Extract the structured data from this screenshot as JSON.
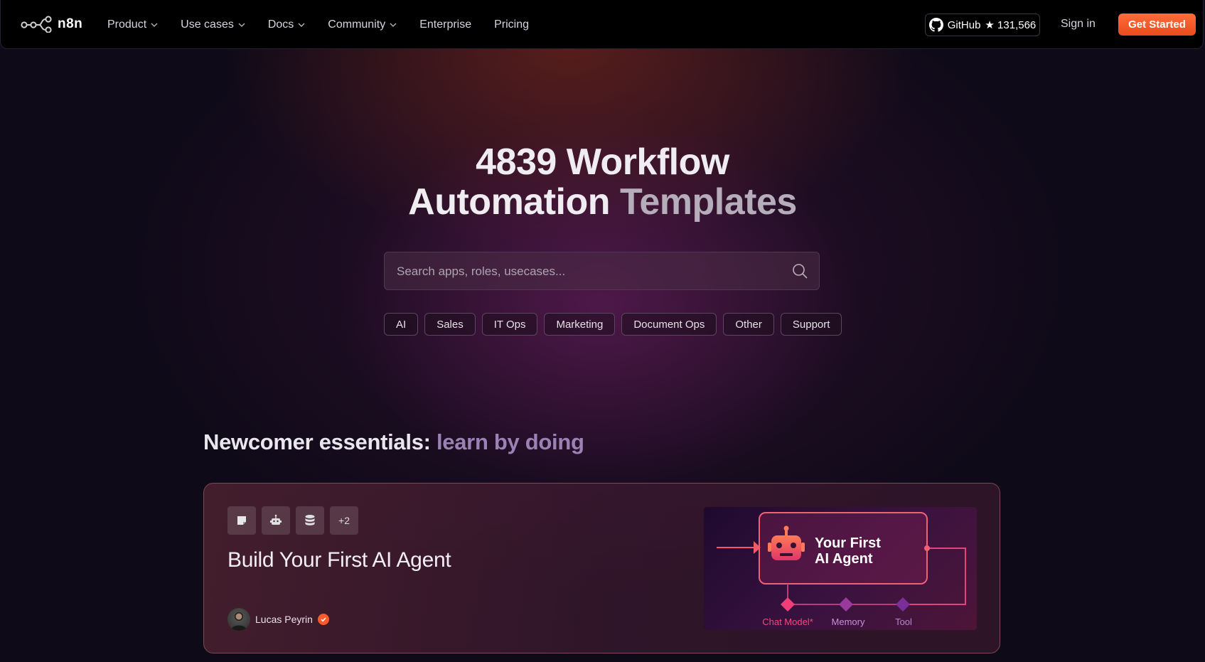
{
  "nav": {
    "logo_text": "n8n",
    "items": [
      {
        "label": "Product",
        "has_dropdown": true
      },
      {
        "label": "Use cases",
        "has_dropdown": true
      },
      {
        "label": "Docs",
        "has_dropdown": true
      },
      {
        "label": "Community",
        "has_dropdown": true
      },
      {
        "label": "Enterprise",
        "has_dropdown": false
      },
      {
        "label": "Pricing",
        "has_dropdown": false
      }
    ],
    "github_label": "GitHub",
    "github_stars": "★ 131,566",
    "sign_in": "Sign in",
    "get_started": "Get Started"
  },
  "hero": {
    "title_line1": "4839 Workflow",
    "title_line2_a": "Automation",
    "title_line2_b": "Templates",
    "search_placeholder": "Search apps, roles, usecases...",
    "categories": [
      "AI",
      "Sales",
      "IT Ops",
      "Marketing",
      "Document Ops",
      "Other",
      "Support"
    ]
  },
  "section": {
    "title_a": "Newcomer essentials:",
    "title_b": "learn by doing"
  },
  "card": {
    "icons": [
      "sticky-note-icon",
      "robot-icon",
      "database-icon"
    ],
    "extra_count": "+2",
    "title": "Build Your First AI Agent",
    "author": "Lucas Peyrin",
    "preview": {
      "title_line1": "Your First",
      "title_line2": "AI Agent",
      "labels": [
        "Chat Model*",
        "Memory",
        "Tool"
      ]
    }
  },
  "colors": {
    "accent": "#ea4b1c",
    "background": "#0e0a18",
    "section_highlight": "#9a83b4"
  }
}
